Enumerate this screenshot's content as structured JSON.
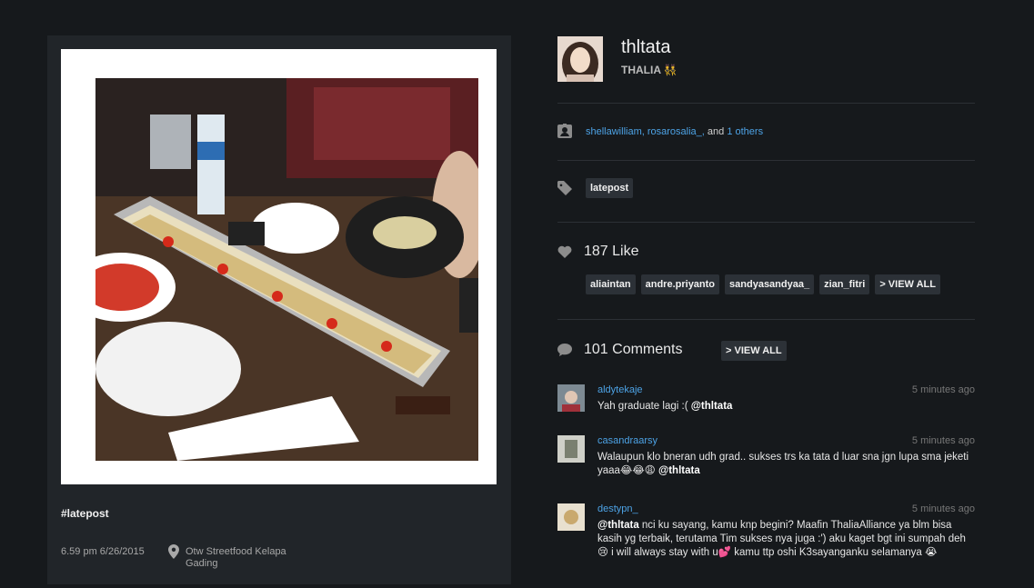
{
  "post": {
    "caption": "#latepost",
    "time": "6.59 pm 6/26/2015",
    "location": "Otw Streetfood Kelapa Gading"
  },
  "profile": {
    "username": "thltata",
    "fullname": "THALIA 👯"
  },
  "tagged": {
    "user1": "shellawilliam,",
    "user2": "rosarosalia_,",
    "and": "and",
    "others": "1 others"
  },
  "tags": [
    "latepost"
  ],
  "likes": {
    "count_label": "187 Like",
    "users": [
      "aliaintan",
      "andre.priyanto",
      "sandyasandyaa_",
      "zian_fitri"
    ],
    "view_all": "> VIEW ALL"
  },
  "comments": {
    "count_label": "101 Comments",
    "view_all": "> VIEW ALL",
    "items": [
      {
        "user": "aldytekaje",
        "time": "5 minutes ago",
        "text": "Yah graduate lagi :( ",
        "mention": "@thltata"
      },
      {
        "user": "casandraarsy",
        "time": "5 minutes ago",
        "text": "Walaupun klo bneran udh grad.. sukses trs ka tata d luar sna jgn lupa sma jeketi yaaa😂😂😩 ",
        "mention": "@thltata"
      },
      {
        "user": "destypn_",
        "time": "5 minutes ago",
        "mention": "@thltata",
        "text": " nci ku sayang, kamu knp begini? Maafin ThaliaAlliance ya blm bisa kasih yg terbaik, terutama Tim sukses nya juga :') aku kaget bgt ini sumpah deh😢 i will always stay with u💕 kamu ttp oshi K3sayanganku selamanya 😭"
      }
    ]
  },
  "icons": {
    "tag_user": "person-badge-icon",
    "tag": "tag-icon",
    "like": "heart-icon",
    "comment": "speech-bubble-icon",
    "location": "location-pin-icon"
  },
  "colors": {
    "background": "#16191c",
    "panel": "#212529",
    "link": "#4da3e6",
    "chip": "#2c3137"
  }
}
